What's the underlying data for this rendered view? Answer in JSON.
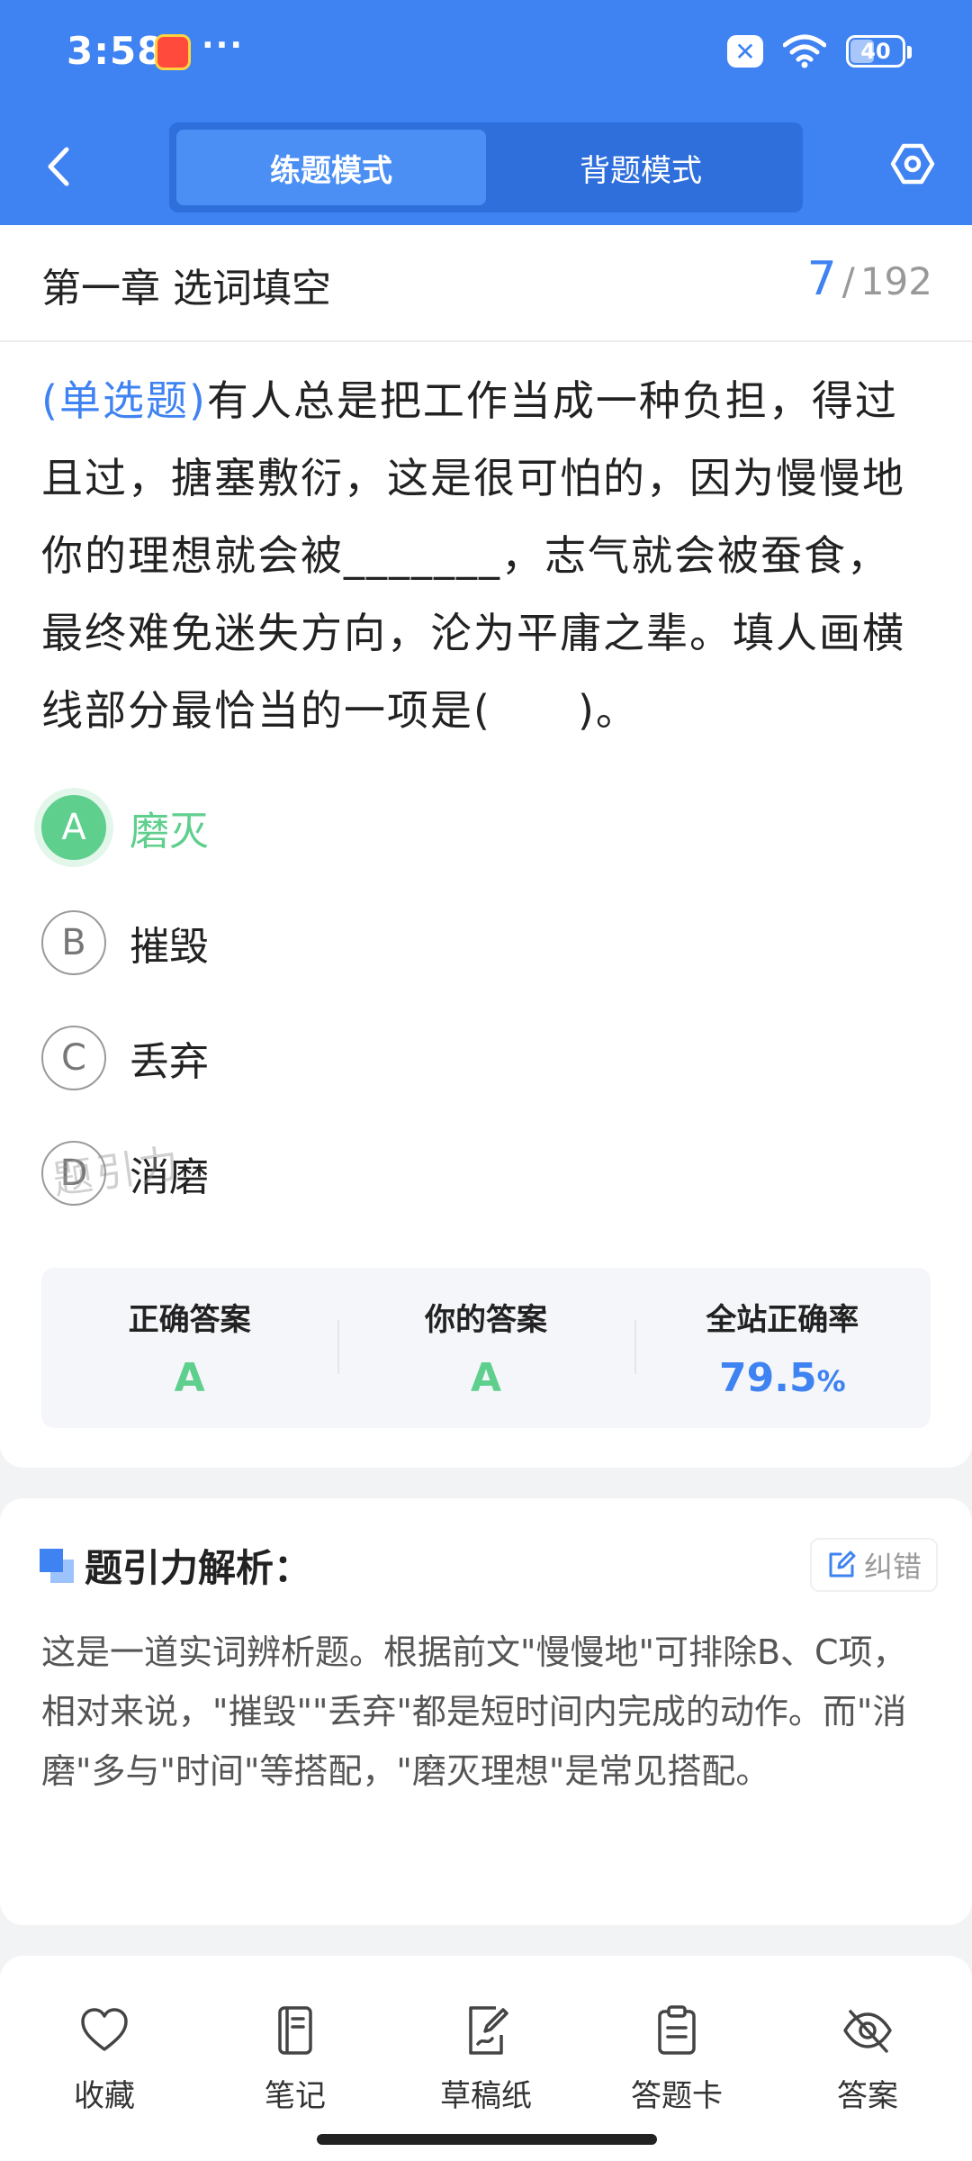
{
  "status_bar": {
    "time": "3:58",
    "dots": "···",
    "battery": "40"
  },
  "header": {
    "tabs": [
      {
        "label": "练题模式",
        "active": true
      },
      {
        "label": "背题模式",
        "active": false
      }
    ]
  },
  "chapter": {
    "title": "第一章 选词填空",
    "current": "7",
    "slash": "/",
    "total": "192"
  },
  "question": {
    "type": "(单选题)",
    "text": "有人总是把工作当成一种负担，得过且过，搪塞敷衍，这是很可怕的，因为慢慢地你的理想就会被_______，志气就会被蚕食，最终难免迷失方向，沦为平庸之辈。填人画横线部分最恰当的一项是(　　)。",
    "options": [
      {
        "letter": "A",
        "text": "磨灭",
        "state": "correct"
      },
      {
        "letter": "B",
        "text": "摧毁",
        "state": "normal"
      },
      {
        "letter": "C",
        "text": "丢弃",
        "state": "normal"
      },
      {
        "letter": "D",
        "text": "消磨",
        "state": "normal"
      }
    ],
    "watermark": "题引力"
  },
  "answers": {
    "correct_label": "正确答案",
    "correct_value": "A",
    "yours_label": "你的答案",
    "yours_value": "A",
    "rate_label": "全站正确率",
    "rate_value": "79.5",
    "rate_unit": "%"
  },
  "analysis": {
    "title": "题引力解析：",
    "report_label": "纠错",
    "text": "这是一道实词辨析题。根据前文\"慢慢地\"可排除B、C项，相对来说，\"摧毁\"\"丢弃\"都是短时间内完成的动作。而\"消磨\"多与\"时间\"等搭配，\"磨灭理想\"是常见搭配。"
  },
  "bottom_nav": [
    {
      "label": "收藏",
      "icon": "heart-icon"
    },
    {
      "label": "笔记",
      "icon": "notebook-icon"
    },
    {
      "label": "草稿纸",
      "icon": "draft-icon"
    },
    {
      "label": "答题卡",
      "icon": "clipboard-icon"
    },
    {
      "label": "答案",
      "icon": "eye-off-icon"
    }
  ],
  "colors": {
    "primary": "#3f82f2",
    "correct": "#5fcf8d"
  }
}
